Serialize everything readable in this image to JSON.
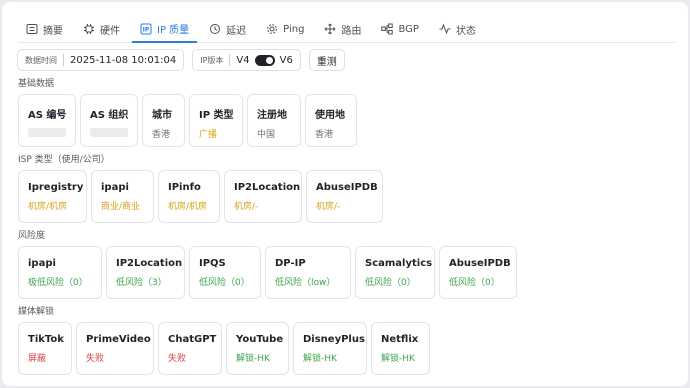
{
  "tabs": [
    {
      "label": "摘要",
      "icon": "summary-icon"
    },
    {
      "label": "硬件",
      "icon": "chip-icon"
    },
    {
      "label": "IP 质量",
      "icon": "ip-icon",
      "active": true
    },
    {
      "label": "延迟",
      "icon": "clock-icon"
    },
    {
      "label": "Ping",
      "icon": "gear-icon"
    },
    {
      "label": "路由",
      "icon": "route-icon"
    },
    {
      "label": "BGP",
      "icon": "network-icon"
    },
    {
      "label": "状态",
      "icon": "activity-icon"
    }
  ],
  "toolbar": {
    "time_label": "数据时间",
    "time_value": "2025-11-08 10:01:04",
    "ipver_label": "IP版本",
    "v4": "V4",
    "v6": "V6",
    "retest": "重测"
  },
  "basic": {
    "title": "基础数据",
    "cards": [
      {
        "title": "AS 编号",
        "value": ""
      },
      {
        "title": "AS 组织",
        "value": ""
      },
      {
        "title": "城市",
        "value": "香港"
      },
      {
        "title": "IP 类型",
        "value": "广播"
      },
      {
        "title": "注册地",
        "value": "中国"
      },
      {
        "title": "使用地",
        "value": "香港"
      }
    ]
  },
  "isp": {
    "title": "ISP 类型（使用/公司）",
    "cards": [
      {
        "title": "Ipregistry",
        "value": "机房/机房"
      },
      {
        "title": "ipapi",
        "value": "商业/商业"
      },
      {
        "title": "IPinfo",
        "value": "机房/机房"
      },
      {
        "title": "IP2Location",
        "value": "机房/-"
      },
      {
        "title": "AbuseIPDB",
        "value": "机房/-"
      }
    ]
  },
  "risk": {
    "title": "风险度",
    "cards": [
      {
        "title": "ipapi",
        "value": "极低风险（0）"
      },
      {
        "title": "IP2Location",
        "value": "低风险（3）"
      },
      {
        "title": "IPQS",
        "value": "低风险（0）"
      },
      {
        "title": "DP-IP",
        "value": "低风险（low）"
      },
      {
        "title": "Scamalytics",
        "value": "低风险（0）"
      },
      {
        "title": "AbuseIPDB",
        "value": "低风险（0）"
      }
    ]
  },
  "media": {
    "title": "媒体解锁",
    "cards": [
      {
        "title": "TikTok",
        "value": "屏蔽"
      },
      {
        "title": "PrimeVideo",
        "value": "失败"
      },
      {
        "title": "ChatGPT",
        "value": "失败"
      },
      {
        "title": "YouTube",
        "value": "解锁-HK"
      },
      {
        "title": "DisneyPlus",
        "value": "解锁-HK"
      },
      {
        "title": "Netflix",
        "value": "解锁-HK"
      }
    ]
  },
  "colors": {
    "accent": "#2a7de1",
    "orange": "#d9a21b",
    "green": "#3fa34d",
    "red": "#d64545"
  }
}
